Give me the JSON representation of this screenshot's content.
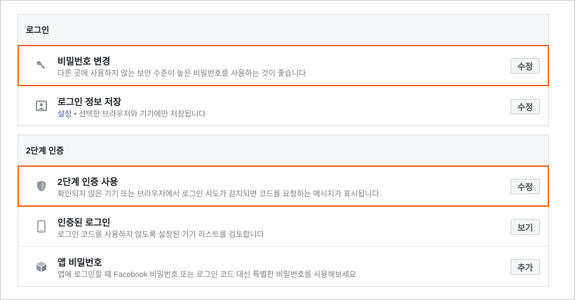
{
  "login": {
    "header": "로그인",
    "rows": [
      {
        "title": "비밀번호 변경",
        "desc": "다른 곳에 사용하지 않는 보안 수준이 높은 비밀번호를 사용하는 것이 좋습니다",
        "button": "수정",
        "icon": "key-icon"
      },
      {
        "title": "로그인 정보 저장",
        "desc_link": "설정",
        "desc": " • 선택한 브라우저와 기기에만 저장됩니다",
        "button": "수정",
        "icon": "profile-card-icon"
      }
    ]
  },
  "two_factor": {
    "header": "2단계 인증",
    "rows": [
      {
        "title": "2단계 인증 사용",
        "desc": "확인되지 않은 기기 또는 브라우저에서 로그인 시도가 감지되면 코드를 요청하는 메시지가 표시됩니다.",
        "button": "수정",
        "icon": "shield-icon"
      },
      {
        "title": "인증된 로그인",
        "desc": "로그인 코드를 사용하지 않도록 설정된 기기 리스트를 검토합니다",
        "button": "보기",
        "icon": "phone-icon"
      },
      {
        "title": "앱 비밀번호",
        "desc": "앱에 로그인할 때 Facebook 비밀번호 또는 로그인 코드 대신 특별한 비밀번호를 사용해보세요",
        "button": "추가",
        "icon": "cube-icon"
      }
    ]
  },
  "colors": {
    "highlight": "#f06b28",
    "link": "#4267b2",
    "icon": "#90949c"
  }
}
